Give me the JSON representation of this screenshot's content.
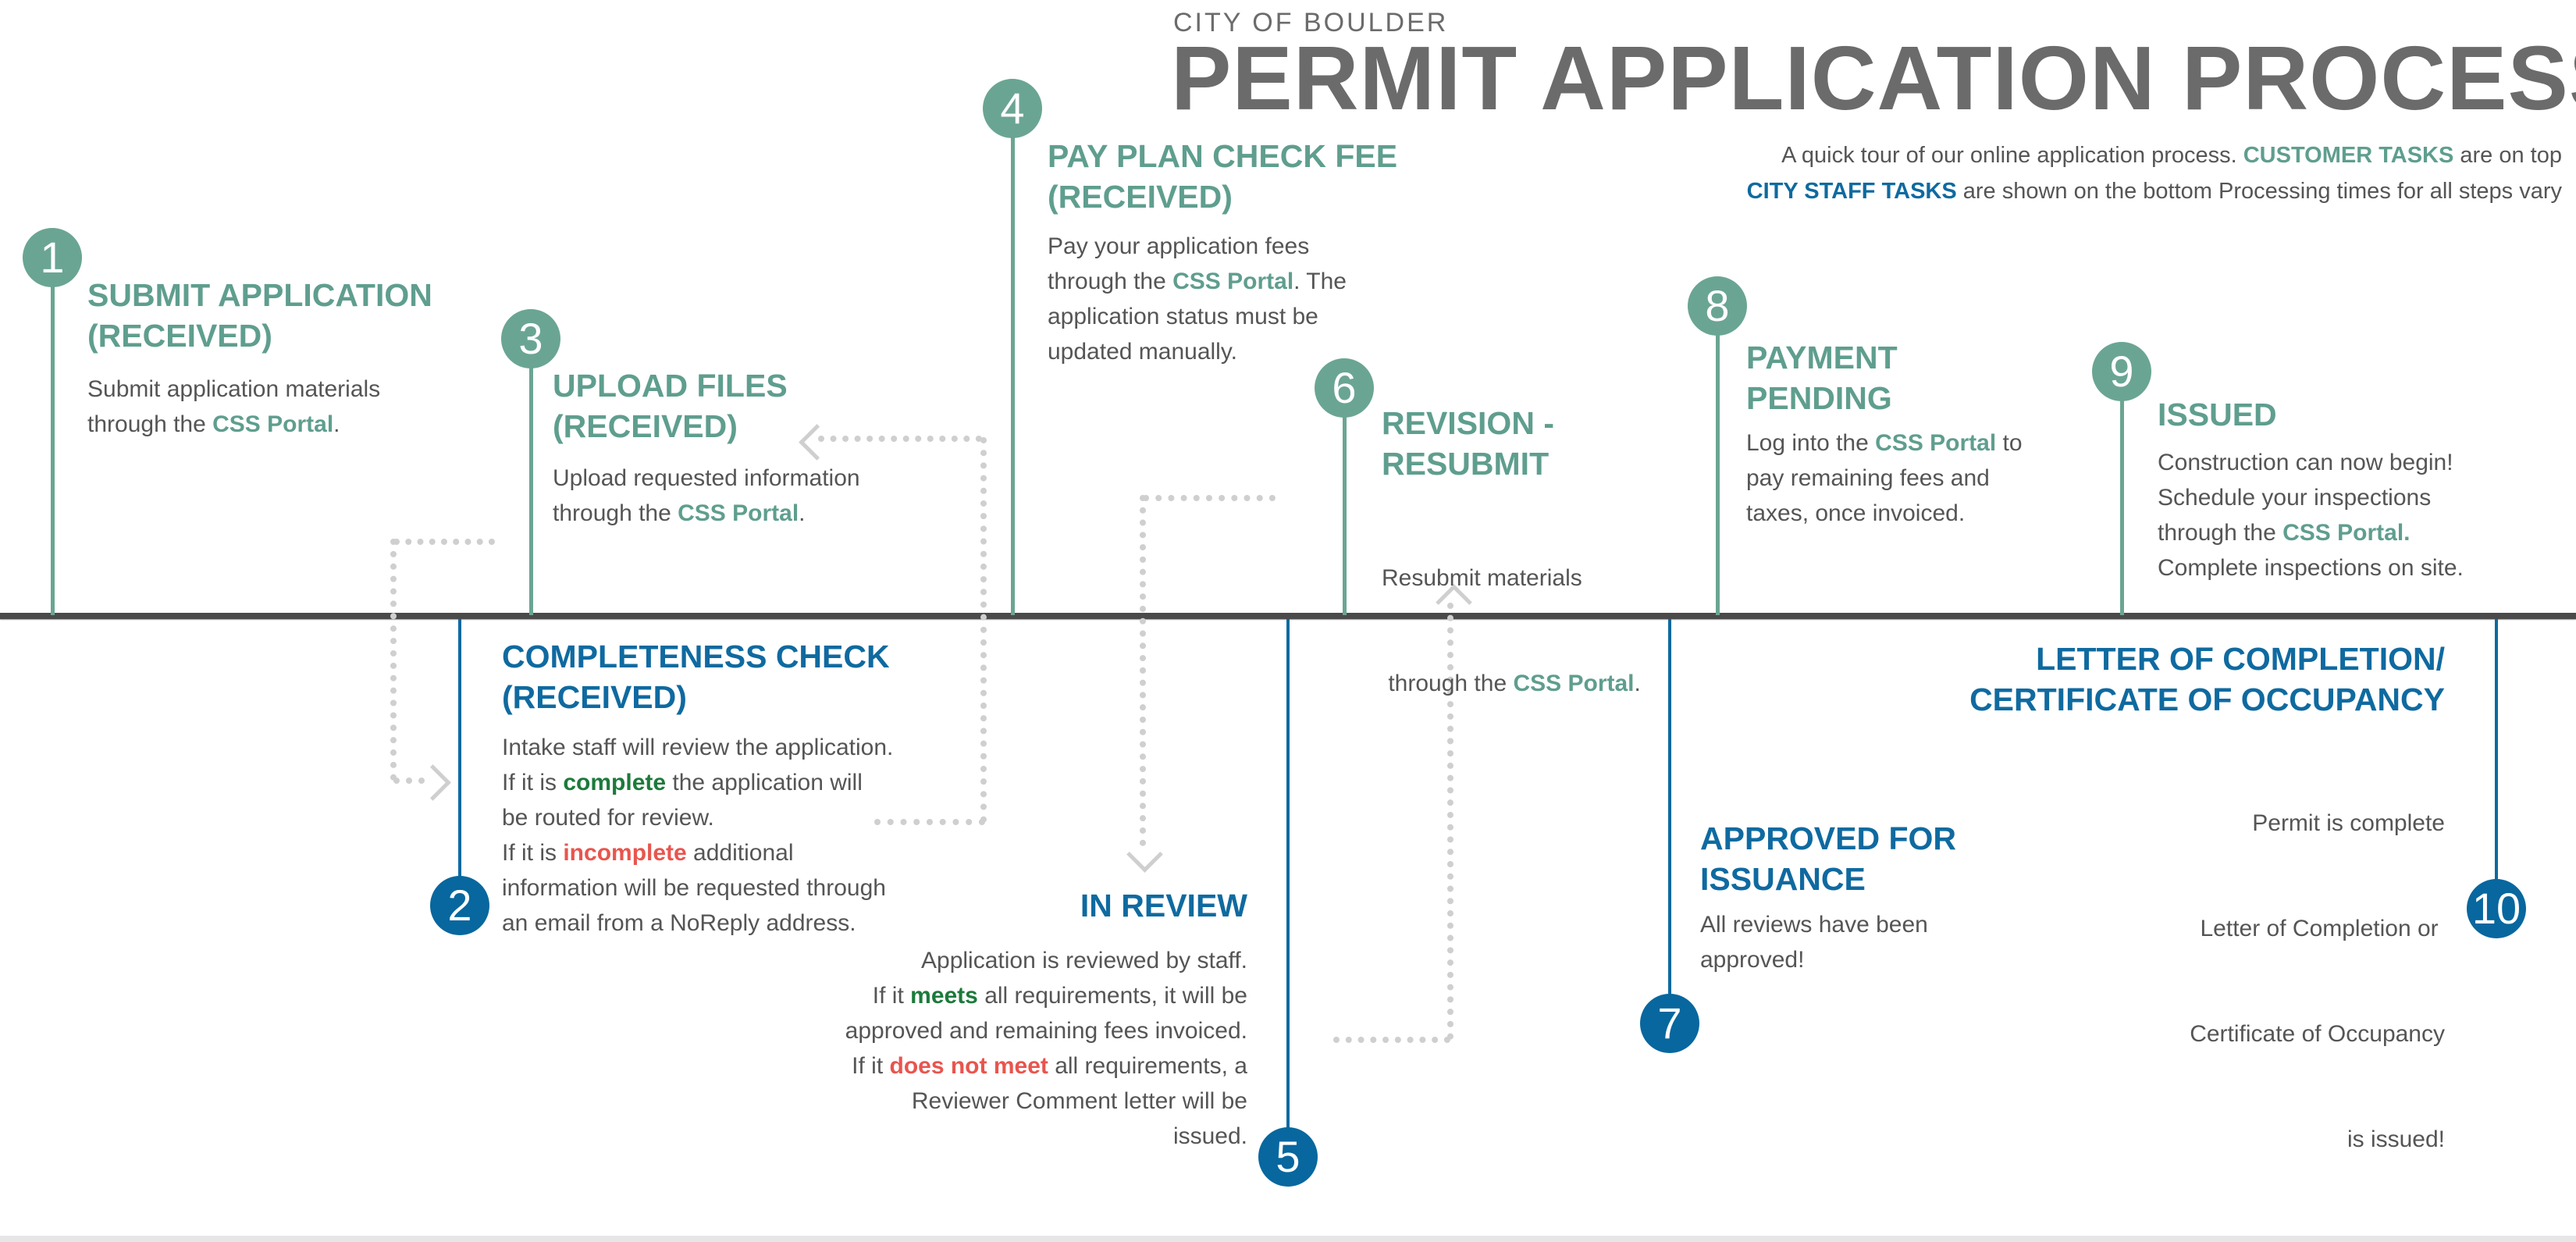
{
  "header": {
    "kicker": "CITY OF BOULDER",
    "title": "PERMIT APPLICATION PROCESS",
    "intro_line1_a": "A quick tour of our online application process. ",
    "intro_line1_b": "CUSTOMER TASKS",
    "intro_line1_c": " are on top",
    "intro_line2_a": "CITY STAFF TASKS",
    "intro_line2_b": " are shown on the bottom Processing times for all steps vary"
  },
  "colors": {
    "customer": "#6aa593",
    "customer_text": "#5f9e8e",
    "staff": "#07679e",
    "staff_text": "#0f6aa0",
    "positive": "#1c7a3b",
    "negative": "#e8554e",
    "title_gray": "#6b6b6b",
    "timeline": "#4a4a4a",
    "connector": "#cfcfcf"
  },
  "portal_label": "CSS Portal",
  "steps": [
    {
      "number": "1",
      "side": "customer",
      "title_l1": "SUBMIT APPLICATION",
      "title_l2": "(RECEIVED)",
      "body": [
        "Submit application materials",
        "through the ",
        "CSS Portal",
        "."
      ]
    },
    {
      "number": "2",
      "side": "staff",
      "title_l1": "COMPLETENESS CHECK",
      "title_l2": "(RECEIVED)",
      "body": [
        "Intake staff will review the application.",
        "If it is ",
        "complete",
        " the application will",
        "be routed for review.",
        "If it is ",
        "incomplete",
        " additional",
        "information will be requested through",
        "an email from a NoReply address."
      ]
    },
    {
      "number": "3",
      "side": "customer",
      "title_l1": "UPLOAD FILES",
      "title_l2": "(RECEIVED)",
      "body": [
        "Upload requested information",
        "through the ",
        "CSS Portal",
        "."
      ]
    },
    {
      "number": "4",
      "side": "customer",
      "title_l1": "PAY PLAN CHECK FEE",
      "title_l2": "(RECEIVED)",
      "body": [
        "Pay your application fees",
        "through the ",
        "CSS Portal",
        ". The",
        "application status must be",
        "updated manually."
      ]
    },
    {
      "number": "5",
      "side": "staff",
      "title_l1": "IN REVIEW",
      "title_l2": "",
      "body": [
        "Application is reviewed by staff.",
        "If it ",
        "meets",
        " all requirements, it will be",
        "approved and remaining fees invoiced.",
        "If it ",
        "does not meet",
        " all requirements, a",
        "Reviewer Comment letter will be",
        "issued."
      ]
    },
    {
      "number": "6",
      "side": "customer",
      "title_l1": "REVISION -",
      "title_l2": "RESUBMIT",
      "body": [
        "Resubmit materials",
        " through the ",
        "CSS Portal",
        "."
      ]
    },
    {
      "number": "7",
      "side": "staff",
      "title_l1": "APPROVED FOR",
      "title_l2": "ISSUANCE",
      "body": [
        "All reviews have been",
        "approved!"
      ]
    },
    {
      "number": "8",
      "side": "customer",
      "title_l1": "PAYMENT",
      "title_l2": "PENDING",
      "body": [
        "Log into the ",
        "CSS Portal",
        " to",
        "pay remaining fees and",
        "taxes, once invoiced."
      ]
    },
    {
      "number": "9",
      "side": "customer",
      "title_l1": "ISSUED",
      "title_l2": "",
      "body": [
        "Construction can now begin!",
        "Schedule your inspections",
        "through the ",
        "CSS Portal",
        ".",
        "Complete inspections on site."
      ]
    },
    {
      "number": "10",
      "side": "staff",
      "title_l1": "LETTER OF COMPLETION/",
      "title_l2": "CERTIFICATE OF OCCUPANCY",
      "body": [
        "Permit is complete",
        "Letter of Completion or ",
        "Certificate of Occupancy",
        "is issued!"
      ]
    }
  ],
  "connectors": [
    {
      "from": "1",
      "to": "2",
      "label": "dotted-arrow-right"
    },
    {
      "from": "2",
      "to": "3",
      "label": "dotted-arrow-left"
    },
    {
      "from": "4",
      "to": "5",
      "label": "dotted-arrow-down"
    },
    {
      "from": "5",
      "to": "6",
      "label": "dotted-arrow-up"
    }
  ]
}
